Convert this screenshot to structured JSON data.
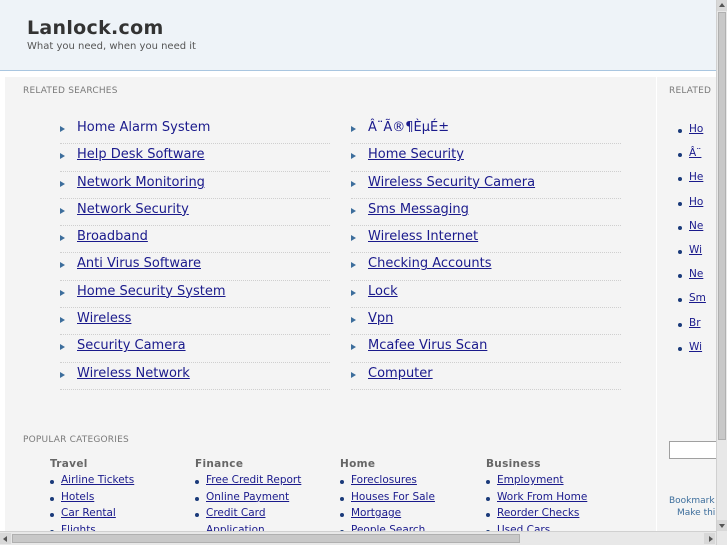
{
  "header": {
    "title": "Lanlock.com",
    "tagline": "What you need, when you need it"
  },
  "related_searches": {
    "heading": "RELATED SEARCHES",
    "col1": [
      "Home Alarm System",
      "Help Desk Software",
      "Network Monitoring",
      "Network Security",
      "Broadband",
      "Anti Virus Software",
      "Home Security System",
      "Wireless",
      "Security Camera",
      "Wireless Network"
    ],
    "col2": [
      "Â¨Ã®¶ÈµÉ±",
      "Home Security",
      "Wireless Security Camera",
      "Sms Messaging",
      "Wireless Internet",
      "Checking Accounts",
      "Lock",
      "Vpn",
      "Mcafee Virus Scan",
      "Computer"
    ]
  },
  "popular_categories": {
    "heading": "POPULAR CATEGORIES",
    "columns": [
      {
        "title": "Travel",
        "items": [
          "Airline Tickets",
          "Hotels",
          "Car Rental",
          "Flights"
        ]
      },
      {
        "title": "Finance",
        "items": [
          "Free Credit Report",
          "Online Payment",
          "Credit Card",
          "Application"
        ]
      },
      {
        "title": "Home",
        "items": [
          "Foreclosures",
          "Houses For Sale",
          "Mortgage",
          "People Search"
        ]
      },
      {
        "title": "Business",
        "items": [
          "Employment",
          "Work From Home",
          "Reorder Checks",
          "Used Cars"
        ]
      }
    ]
  },
  "right_panel": {
    "heading": "RELATED",
    "items": [
      "Ho",
      "Â¨",
      "He",
      "Ho",
      "Ne",
      "Wi",
      "Ne",
      "Sm",
      "Br",
      "Wi"
    ],
    "bookmark_text": "Bookmark",
    "make_text": "Make thi"
  },
  "colors": {
    "link": "#1a1a8c",
    "arrow": "#3d6e9c",
    "header_bg": "#eef3f8",
    "panel_bg": "#f4f4f4"
  }
}
